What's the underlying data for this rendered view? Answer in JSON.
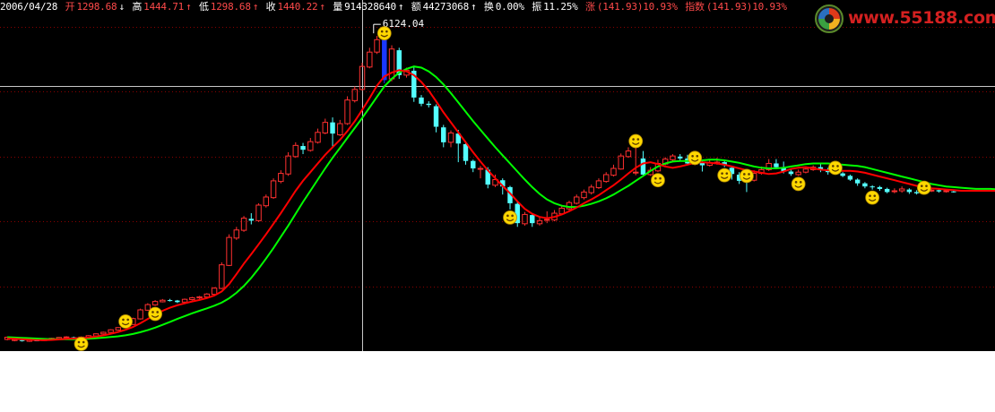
{
  "info_bar": {
    "date": "2006/04/28",
    "open_label": "开",
    "open_value": "1298.68",
    "open_arrow": "↓",
    "high_label": "高",
    "high_value": "1444.71",
    "high_arrow": "↑",
    "low_label": "低",
    "low_value": "1298.68",
    "low_arrow": "↑",
    "close_label": "收",
    "close_value": "1440.22",
    "close_arrow": "↑",
    "volume_label": "量",
    "volume_value": "914328640",
    "volume_arrow": "↑",
    "amount_label": "额",
    "amount_value": "44273068",
    "amount_arrow": "↑",
    "turnover_label": "换",
    "turnover_value": "0.00%",
    "amplitude_label": "振",
    "amplitude_value": "11.25%",
    "change_label": "涨",
    "change_value": "(141.93)10.93%",
    "index_label": "指数",
    "index_value": "(141.93)10.93%"
  },
  "logo": {
    "text": "www.55188.com"
  },
  "colors": {
    "background": "#000000",
    "up": "#ff3030",
    "down": "#54ffff",
    "ma_fast": "#ff0000",
    "ma_slow": "#00ff00",
    "grid": "#8b0000",
    "crosshair": "#c8c8c8",
    "smiley": "#ffd800",
    "highlight": "#1a38ff"
  },
  "chart_data": {
    "type": "candlestick",
    "title": "",
    "xlabel": "",
    "ylabel": "",
    "ylim": [
      1100,
      6400
    ],
    "max_label": "6124.04",
    "grid": true,
    "crosshair": {
      "index": 48,
      "price": 5300
    },
    "candles": [
      [
        1230,
        1265,
        1215,
        1275
      ],
      [
        1212,
        1228,
        1200,
        1240
      ],
      [
        1218,
        1205,
        1195,
        1230
      ],
      [
        1200,
        1225,
        1190,
        1232
      ],
      [
        1215,
        1208,
        1200,
        1225
      ],
      [
        1212,
        1228,
        1205,
        1235
      ],
      [
        1222,
        1248,
        1215,
        1255
      ],
      [
        1240,
        1262,
        1235,
        1270
      ],
      [
        1258,
        1270,
        1248,
        1282
      ],
      [
        1265,
        1250,
        1240,
        1275
      ],
      [
        1252,
        1268,
        1245,
        1278
      ],
      [
        1265,
        1290,
        1258,
        1298
      ],
      [
        1285,
        1320,
        1280,
        1328
      ],
      [
        1318,
        1345,
        1310,
        1355
      ],
      [
        1342,
        1385,
        1338,
        1395
      ],
      [
        1380,
        1420,
        1372,
        1428
      ],
      [
        1418,
        1478,
        1410,
        1490
      ],
      [
        1470,
        1565,
        1465,
        1580
      ],
      [
        1560,
        1705,
        1550,
        1725
      ],
      [
        1700,
        1790,
        1690,
        1812
      ],
      [
        1785,
        1840,
        1770,
        1862
      ],
      [
        1835,
        1860,
        1825,
        1880
      ],
      [
        1862,
        1855,
        1840,
        1882
      ],
      [
        1855,
        1830,
        1815,
        1865
      ],
      [
        1830,
        1875,
        1822,
        1888
      ],
      [
        1870,
        1900,
        1858,
        1915
      ],
      [
        1898,
        1915,
        1880,
        1930
      ],
      [
        1912,
        1960,
        1905,
        1975
      ],
      [
        1955,
        2055,
        1948,
        2070
      ],
      [
        2050,
        2430,
        2040,
        2470
      ],
      [
        2420,
        2870,
        2410,
        2920
      ],
      [
        2860,
        2990,
        2830,
        3040
      ],
      [
        2985,
        3180,
        2960,
        3215
      ],
      [
        3170,
        3140,
        3080,
        3260
      ],
      [
        3140,
        3390,
        3120,
        3420
      ],
      [
        3380,
        3520,
        3350,
        3560
      ],
      [
        3510,
        3780,
        3490,
        3820
      ],
      [
        3770,
        3900,
        3740,
        3950
      ],
      [
        3890,
        4180,
        3860,
        4240
      ],
      [
        4170,
        4350,
        4150,
        4400
      ],
      [
        4340,
        4280,
        4210,
        4390
      ],
      [
        4270,
        4410,
        4250,
        4470
      ],
      [
        4400,
        4560,
        4380,
        4620
      ],
      [
        4550,
        4720,
        4530,
        4780
      ],
      [
        4720,
        4540,
        4320,
        4800
      ],
      [
        4520,
        4700,
        4500,
        4760
      ],
      [
        4700,
        5080,
        4680,
        5140
      ],
      [
        5070,
        5250,
        5040,
        5300
      ],
      [
        5250,
        5620,
        5230,
        5680
      ],
      [
        5610,
        5850,
        5590,
        5920
      ],
      [
        5850,
        6050,
        5820,
        6110
      ],
      [
        6050,
        5400,
        5350,
        6124
      ],
      [
        5420,
        5900,
        5380,
        5960
      ],
      [
        5880,
        5480,
        5420,
        5920
      ],
      [
        5480,
        5560,
        5440,
        5600
      ],
      [
        5550,
        5120,
        5050,
        5620
      ],
      [
        5120,
        5020,
        4980,
        5160
      ],
      [
        5020,
        5000,
        4960,
        5060
      ],
      [
        4980,
        4650,
        4560,
        5010
      ],
      [
        4640,
        4400,
        4320,
        4680
      ],
      [
        4400,
        4550,
        4320,
        4590
      ],
      [
        4540,
        4380,
        4080,
        4600
      ],
      [
        4370,
        4100,
        4040,
        4420
      ],
      [
        4100,
        3980,
        3920,
        4120
      ],
      [
        3980,
        3980,
        3820,
        4020
      ],
      [
        3960,
        3720,
        3660,
        4000
      ],
      [
        3710,
        3800,
        3680,
        3880
      ],
      [
        3790,
        3690,
        3560,
        3820
      ],
      [
        3680,
        3420,
        3320,
        3700
      ],
      [
        3410,
        3100,
        3040,
        3450
      ],
      [
        3090,
        3240,
        3060,
        3280
      ],
      [
        3230,
        3100,
        3040,
        3260
      ],
      [
        3090,
        3140,
        3060,
        3210
      ],
      [
        3150,
        3160,
        3100,
        3290
      ],
      [
        3150,
        3260,
        3130,
        3310
      ],
      [
        3250,
        3340,
        3230,
        3380
      ],
      [
        3330,
        3430,
        3300,
        3460
      ],
      [
        3420,
        3520,
        3400,
        3560
      ],
      [
        3510,
        3600,
        3480,
        3640
      ],
      [
        3590,
        3680,
        3560,
        3720
      ],
      [
        3670,
        3780,
        3650,
        3820
      ],
      [
        3770,
        3880,
        3750,
        3920
      ],
      [
        3870,
        3980,
        3850,
        4040
      ],
      [
        3970,
        4180,
        3960,
        4220
      ],
      [
        4170,
        4260,
        4150,
        4320
      ],
      [
        3920,
        3920,
        3870,
        4390
      ],
      [
        4140,
        3880,
        3850,
        4260
      ],
      [
        3880,
        3950,
        3860,
        4000
      ],
      [
        3940,
        4060,
        3920,
        4120
      ],
      [
        4050,
        4130,
        4030,
        4160
      ],
      [
        4120,
        4180,
        4100,
        4210
      ],
      [
        4170,
        4140,
        4110,
        4210
      ],
      [
        4140,
        4060,
        4040,
        4200
      ],
      [
        4060,
        4060,
        4030,
        4120
      ],
      [
        4080,
        4030,
        3930,
        4110
      ],
      [
        4030,
        4070,
        4010,
        4130
      ],
      [
        4060,
        4080,
        4040,
        4150
      ],
      [
        4080,
        4030,
        4000,
        4110
      ],
      [
        3990,
        3890,
        3800,
        4020
      ],
      [
        3880,
        3780,
        3730,
        3920
      ],
      [
        3790,
        3780,
        3600,
        3830
      ],
      [
        3790,
        3900,
        3770,
        3950
      ],
      [
        3900,
        3960,
        3880,
        4010
      ],
      [
        3960,
        4060,
        3940,
        4130
      ],
      [
        4060,
        4000,
        3970,
        4130
      ],
      [
        4000,
        3930,
        3900,
        4090
      ],
      [
        3930,
        3890,
        3860,
        3960
      ],
      [
        3880,
        3920,
        3860,
        3960
      ],
      [
        3920,
        3970,
        3900,
        4000
      ],
      [
        3960,
        4000,
        3940,
        4030
      ],
      [
        4000,
        3960,
        3920,
        4060
      ],
      [
        3960,
        3920,
        3880,
        3990
      ],
      [
        3920,
        3900,
        3880,
        3960
      ],
      [
        3900,
        3860,
        3840,
        3920
      ],
      [
        3860,
        3800,
        3780,
        3880
      ],
      [
        3800,
        3740,
        3700,
        3820
      ],
      [
        3740,
        3690,
        3660,
        3760
      ],
      [
        3690,
        3680,
        3640,
        3710
      ],
      [
        3680,
        3650,
        3620,
        3700
      ],
      [
        3650,
        3600,
        3580,
        3670
      ],
      [
        3610,
        3620,
        3580,
        3660
      ],
      [
        3620,
        3650,
        3590,
        3690
      ],
      [
        3640,
        3600,
        3570,
        3660
      ],
      [
        3600,
        3580,
        3560,
        3630
      ],
      [
        3580,
        3620,
        3560,
        3640
      ],
      [
        3620,
        3630,
        3600,
        3660
      ],
      [
        3630,
        3610,
        3590,
        3650
      ],
      [
        3610,
        3620,
        3590,
        3640
      ],
      [
        3610,
        3600,
        3590,
        3630
      ]
    ],
    "ma_fast": [
      1245,
      1240,
      1232,
      1225,
      1220,
      1218,
      1222,
      1230,
      1240,
      1246,
      1252,
      1260,
      1275,
      1295,
      1320,
      1350,
      1385,
      1430,
      1490,
      1560,
      1625,
      1690,
      1740,
      1780,
      1810,
      1840,
      1865,
      1895,
      1935,
      2000,
      2120,
      2280,
      2450,
      2600,
      2760,
      2920,
      3090,
      3260,
      3440,
      3620,
      3780,
      3920,
      4060,
      4200,
      4320,
      4440,
      4580,
      4740,
      4920,
      5110,
      5310,
      5460,
      5520,
      5560,
      5540,
      5480,
      5370,
      5230,
      5060,
      4880,
      4720,
      4560,
      4400,
      4240,
      4090,
      3950,
      3820,
      3700,
      3580,
      3450,
      3330,
      3250,
      3200,
      3180,
      3200,
      3240,
      3290,
      3350,
      3420,
      3480,
      3550,
      3630,
      3710,
      3800,
      3900,
      3990,
      4060,
      4080,
      4050,
      4010,
      3990,
      4010,
      4040,
      4070,
      4080,
      4070,
      4060,
      4040,
      4010,
      3980,
      3950,
      3930,
      3910,
      3890,
      3900,
      3930,
      3970,
      3990,
      4000,
      3980,
      3960,
      3950,
      3940,
      3940,
      3940,
      3930,
      3910,
      3880,
      3850,
      3820,
      3790,
      3760,
      3730,
      3700,
      3680,
      3660,
      3650,
      3640,
      3630,
      3620,
      3620,
      3620,
      3620,
      3620,
      3620
    ],
    "ma_slow": [
      1265,
      1260,
      1255,
      1250,
      1244,
      1238,
      1234,
      1232,
      1232,
      1234,
      1238,
      1243,
      1250,
      1258,
      1268,
      1280,
      1296,
      1318,
      1346,
      1380,
      1420,
      1465,
      1512,
      1560,
      1606,
      1650,
      1690,
      1730,
      1772,
      1822,
      1890,
      1980,
      2090,
      2220,
      2370,
      2530,
      2700,
      2880,
      3060,
      3250,
      3440,
      3620,
      3800,
      3980,
      4150,
      4310,
      4470,
      4630,
      4790,
      4960,
      5130,
      5300,
      5420,
      5520,
      5580,
      5620,
      5600,
      5540,
      5450,
      5330,
      5190,
      5040,
      4890,
      4740,
      4600,
      4460,
      4320,
      4190,
      4060,
      3930,
      3800,
      3680,
      3570,
      3480,
      3420,
      3380,
      3360,
      3360,
      3380,
      3410,
      3450,
      3500,
      3560,
      3630,
      3700,
      3780,
      3860,
      3940,
      4010,
      4060,
      4090,
      4100,
      4100,
      4100,
      4110,
      4120,
      4120,
      4110,
      4090,
      4070,
      4040,
      4010,
      3990,
      3980,
      3980,
      3990,
      4010,
      4030,
      4050,
      4060,
      4060,
      4060,
      4050,
      4040,
      4030,
      4020,
      4000,
      3970,
      3940,
      3910,
      3880,
      3850,
      3820,
      3790,
      3760,
      3730,
      3710,
      3690,
      3680,
      3670,
      3660,
      3650,
      3650,
      3650,
      3640
    ],
    "signals": [
      {
        "index": 10,
        "side": "below"
      },
      {
        "index": 16,
        "side": "above"
      },
      {
        "index": 20,
        "side": "below"
      },
      {
        "index": 51,
        "side": "above"
      },
      {
        "index": 68,
        "side": "below"
      },
      {
        "index": 85,
        "side": "above"
      },
      {
        "index": 88,
        "side": "below"
      },
      {
        "index": 93,
        "side": "above"
      },
      {
        "index": 97,
        "side": "below"
      },
      {
        "index": 100,
        "side": "above"
      },
      {
        "index": 107,
        "side": "below"
      },
      {
        "index": 112,
        "side": "above"
      },
      {
        "index": 117,
        "side": "below"
      },
      {
        "index": 124,
        "side": "above"
      },
      {
        "index": 131,
        "side": "below"
      },
      {
        "index": 134,
        "side": "above"
      },
      {
        "index": 137,
        "side": "below"
      },
      {
        "index": 140,
        "side": "above"
      }
    ]
  }
}
